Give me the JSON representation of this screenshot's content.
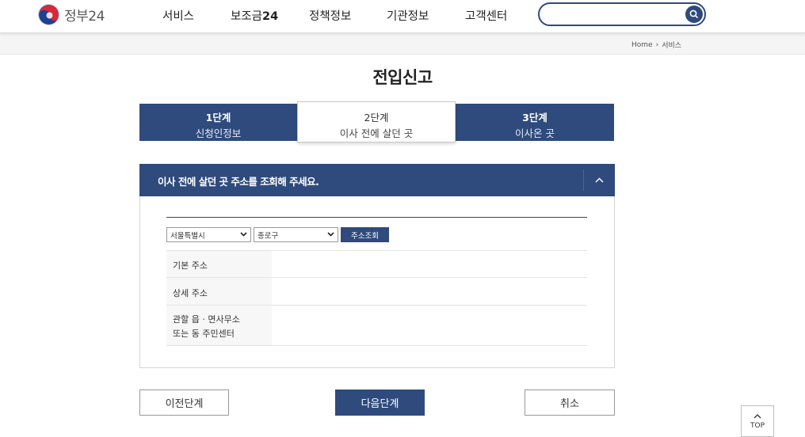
{
  "header": {
    "logo_text": "정부24",
    "nav": [
      {
        "label": "서비스"
      },
      {
        "label": "보조금"
      },
      {
        "label": "정책정보"
      },
      {
        "label": "기관정보"
      },
      {
        "label": "고객센터"
      }
    ],
    "nav_bold_suffix": "24",
    "search_value": ""
  },
  "breadcrumb": {
    "home": "Home",
    "sep": "›",
    "current": "서비스"
  },
  "page_title": "전입신고",
  "steps": [
    {
      "num": "1단계",
      "label": "신청인정보",
      "active": false
    },
    {
      "num": "2단계",
      "label": "이사 전에 살던 곳",
      "active": true
    },
    {
      "num": "3단계",
      "label": "이사온 곳",
      "active": false
    }
  ],
  "section": {
    "title": "이사 전에 살던 곳 주소를 조회해 주세요.",
    "city_select": "서울특별시",
    "district_select": "종로구",
    "lookup_button": "주소조회",
    "rows": [
      {
        "label_lines": [
          "기본 주소"
        ],
        "value": ""
      },
      {
        "label_lines": [
          "상세 주소"
        ],
        "value": ""
      },
      {
        "label_lines": [
          "관할 읍 · 면사무소",
          "또는 동 주민센터"
        ],
        "value": ""
      }
    ]
  },
  "buttons": {
    "prev": "이전단계",
    "next": "다음단계",
    "cancel": "취소"
  },
  "top_button": "TOP",
  "colors": {
    "primary": "#2f4a7c",
    "border": "#d4d4d4"
  }
}
